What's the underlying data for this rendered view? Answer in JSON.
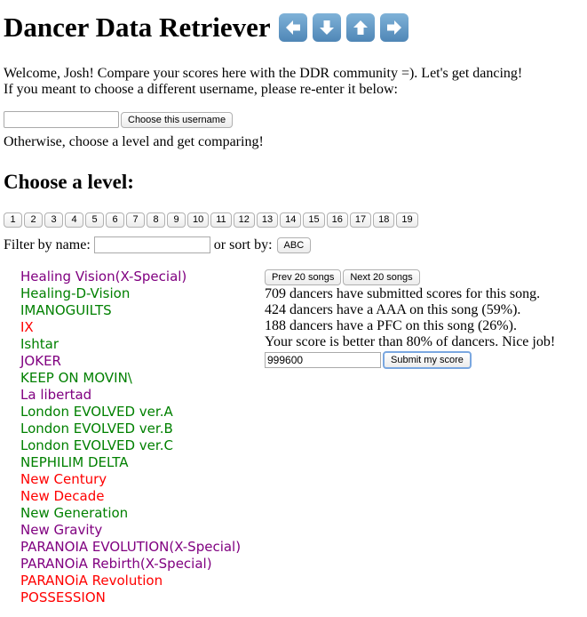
{
  "header": {
    "title": "Dancer Data Retriever",
    "arrow_icons": [
      "arrow-left-icon",
      "arrow-down-icon",
      "arrow-up-icon",
      "arrow-right-icon"
    ],
    "arrow_color": "#5b8fc0"
  },
  "welcome": {
    "line1": "Welcome, Josh! Compare your scores here with the DDR community =). Let's get dancing!",
    "line2": "If you meant to choose a different username, please re-enter it below:"
  },
  "username_form": {
    "value": "",
    "placeholder": "",
    "button_label": "Choose this username"
  },
  "otherwise_text": "Otherwise, choose a level and get comparing!",
  "levels": {
    "heading": "Choose a level:",
    "buttons": [
      "1",
      "2",
      "3",
      "4",
      "5",
      "6",
      "7",
      "8",
      "9",
      "10",
      "11",
      "12",
      "13",
      "14",
      "15",
      "16",
      "17",
      "18",
      "19"
    ]
  },
  "filter": {
    "label": "Filter by name:",
    "value": "",
    "sort_label": "or sort by:",
    "sort_button": "ABC"
  },
  "songs": [
    {
      "name": "Healing Vision(X-Special)",
      "color": "#800080"
    },
    {
      "name": "Healing-D-Vision",
      "color": "#008000"
    },
    {
      "name": "IMANOGUILTS",
      "color": "#008000"
    },
    {
      "name": "IX",
      "color": "#ff0000"
    },
    {
      "name": "Ishtar",
      "color": "#008000"
    },
    {
      "name": "JOKER",
      "color": "#800080"
    },
    {
      "name": "KEEP ON MOVIN\\",
      "color": "#008000"
    },
    {
      "name": "La libertad",
      "color": "#800080"
    },
    {
      "name": "London EVOLVED ver.A",
      "color": "#008000"
    },
    {
      "name": "London EVOLVED ver.B",
      "color": "#008000"
    },
    {
      "name": "London EVOLVED ver.C",
      "color": "#008000"
    },
    {
      "name": "NEPHILIM DELTA",
      "color": "#008000"
    },
    {
      "name": "New Century",
      "color": "#ff0000"
    },
    {
      "name": "New Decade",
      "color": "#ff0000"
    },
    {
      "name": "New Generation",
      "color": "#008000"
    },
    {
      "name": "New Gravity",
      "color": "#800080"
    },
    {
      "name": "PARANOIA EVOLUTION(X-Special)",
      "color": "#800080"
    },
    {
      "name": "PARANOiA Rebirth(X-Special)",
      "color": "#800080"
    },
    {
      "name": "PARANOiA Revolution",
      "color": "#ff0000"
    },
    {
      "name": "POSSESSION",
      "color": "#ff0000"
    }
  ],
  "panel": {
    "prev_label": "Prev 20 songs",
    "next_label": "Next 20 songs",
    "stats": [
      "709 dancers have submitted scores for this song.",
      "424 dancers have a AAA on this song (59%).",
      "188 dancers have a PFC on this song (26%).",
      "Your score is better than 80% of dancers. Nice job!"
    ],
    "score_value": "999600",
    "submit_label": "Submit my score"
  }
}
